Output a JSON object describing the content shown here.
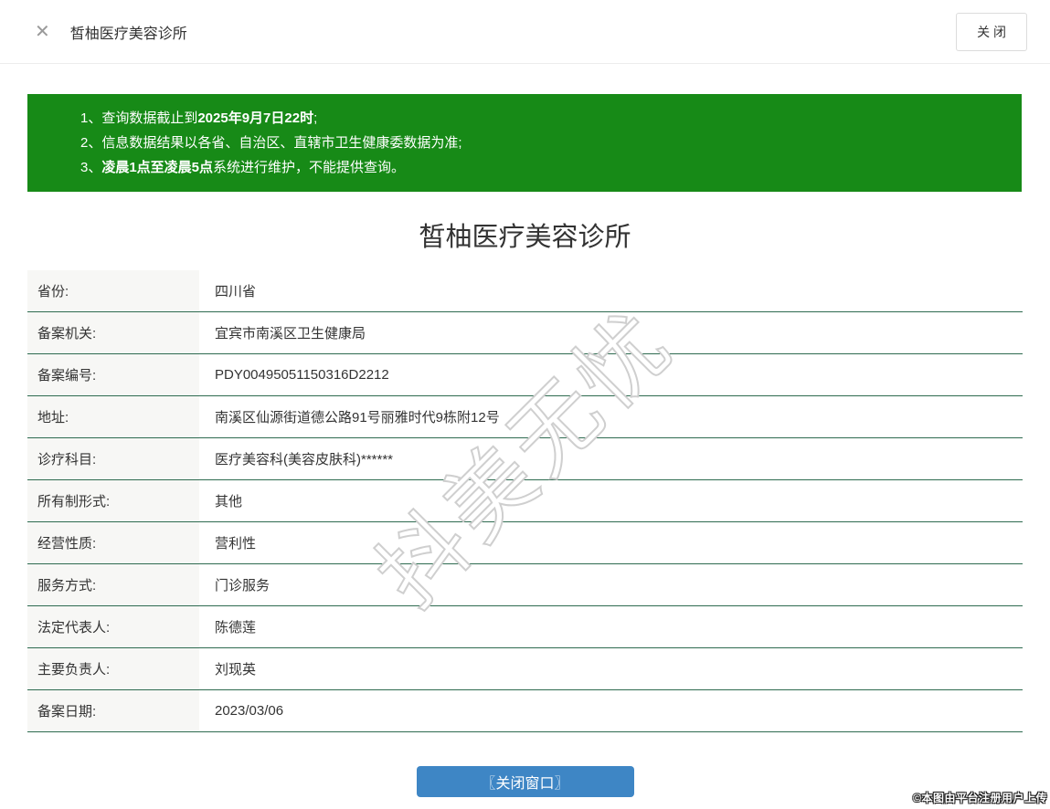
{
  "header": {
    "title": "皙柚医疗美容诊所",
    "close_icon": "✕",
    "close_button_label": "关 闭"
  },
  "notice": {
    "lines": [
      {
        "prefix": "1、查询数据截止到",
        "bold": "2025年9月7日22时",
        "suffix": ";"
      },
      {
        "prefix": "2、信息数据结果以各省、自治区、直辖市卫生健康委数据为准;",
        "bold": "",
        "suffix": ""
      },
      {
        "prefix": "3、",
        "bold": "凌晨1点至凌晨5点",
        "suffix": "系统进行维护，不能提供查询。"
      }
    ]
  },
  "clinic": {
    "title": "皙柚医疗美容诊所",
    "rows": [
      {
        "label": "省份:",
        "value": "四川省"
      },
      {
        "label": "备案机关:",
        "value": "宜宾市南溪区卫生健康局"
      },
      {
        "label": "备案编号:",
        "value": "PDY00495051150316D2212"
      },
      {
        "label": "地址:",
        "value": "南溪区仙源街道德公路91号丽雅时代9栋附12号"
      },
      {
        "label": "诊疗科目:",
        "value": "医疗美容科(美容皮肤科)******"
      },
      {
        "label": "所有制形式:",
        "value": "其他"
      },
      {
        "label": "经营性质:",
        "value": "营利性"
      },
      {
        "label": "服务方式:",
        "value": "门诊服务"
      },
      {
        "label": "法定代表人:",
        "value": "陈德莲"
      },
      {
        "label": "主要负责人:",
        "value": "刘现英"
      },
      {
        "label": "备案日期:",
        "value": "2023/03/06"
      }
    ]
  },
  "footer": {
    "close_window_button": "〖关闭窗口〗",
    "copyright": "©本图由平台注册用户上传"
  },
  "watermark": "抖美无忧",
  "colors": {
    "notice_green": "#178a17",
    "border_green": "#2e6b50",
    "button_blue": "#3e86c5",
    "label_bg": "#f7f7f5"
  }
}
